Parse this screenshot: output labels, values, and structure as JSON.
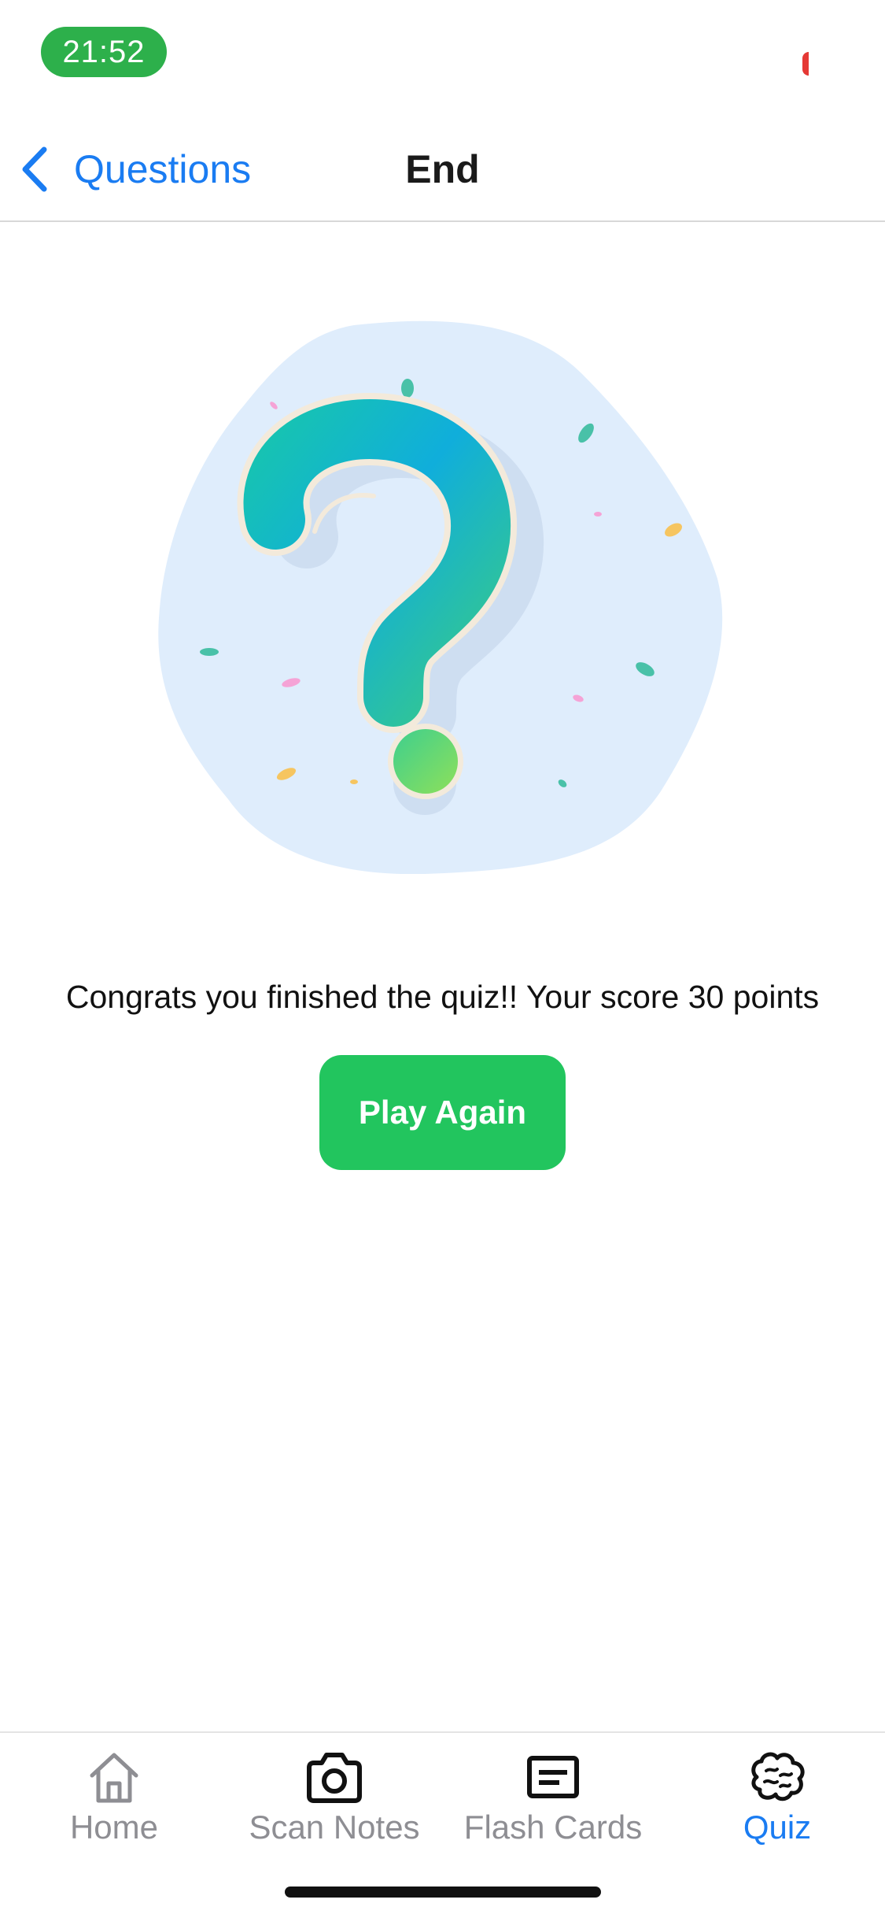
{
  "status_bar": {
    "time": "21:52",
    "time_pill_color": "#2db04b",
    "recording_color": "#e53935"
  },
  "nav": {
    "back_label": "Questions",
    "back_icon": "chevron-left-icon",
    "title": "End",
    "accent_color": "#1a7cf2"
  },
  "illustration": {
    "icon": "question-mark-illustration"
  },
  "result": {
    "message": "Congrats you finished the quiz!! Your score 30 points",
    "score": 30
  },
  "actions": {
    "play_again_label": "Play Again",
    "button_color": "#22c55e"
  },
  "tab_bar": {
    "items": [
      {
        "label": "Home",
        "icon": "home-icon",
        "active": false
      },
      {
        "label": "Scan Notes",
        "icon": "camera-icon",
        "active": false
      },
      {
        "label": "Flash Cards",
        "icon": "card-icon",
        "active": false
      },
      {
        "label": "Quiz",
        "icon": "brain-icon",
        "active": true
      }
    ],
    "active_color": "#1a7cf2",
    "inactive_color": "#8e8e93"
  }
}
